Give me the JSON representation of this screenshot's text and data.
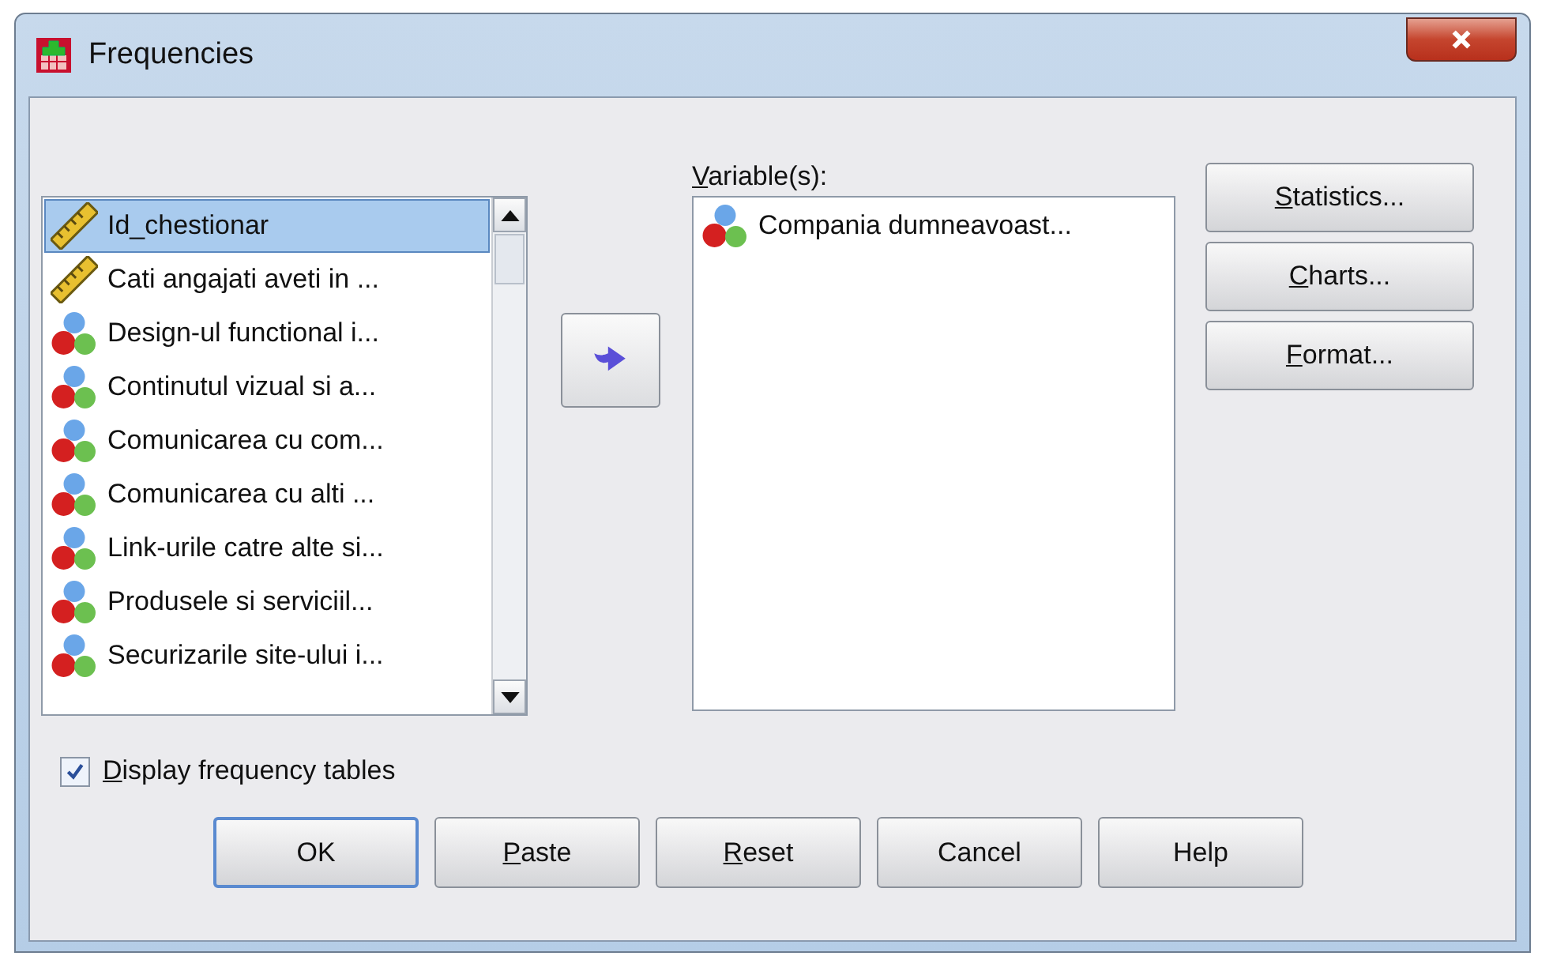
{
  "window": {
    "title": "Frequencies"
  },
  "source_list": {
    "items": [
      {
        "label": "Id_chestionar",
        "kind": "scale",
        "selected": true
      },
      {
        "label": "Cati angajati aveti in ...",
        "kind": "scale",
        "selected": false
      },
      {
        "label": "Design-ul functional i...",
        "kind": "nominal",
        "selected": false
      },
      {
        "label": "Continutul vizual si a...",
        "kind": "nominal",
        "selected": false
      },
      {
        "label": "Comunicarea cu com...",
        "kind": "nominal",
        "selected": false
      },
      {
        "label": "Comunicarea cu alti ...",
        "kind": "nominal",
        "selected": false
      },
      {
        "label": "Link-urile catre alte si...",
        "kind": "nominal",
        "selected": false
      },
      {
        "label": "Produsele si serviciil...",
        "kind": "nominal",
        "selected": false
      },
      {
        "label": "Securizarile site-ului i...",
        "kind": "nominal",
        "selected": false
      }
    ]
  },
  "variables": {
    "label": "Variable(s):",
    "mnemonic_underlined": true,
    "items": [
      {
        "label": "Compania dumneavoast...",
        "kind": "nominal",
        "selected": false
      }
    ]
  },
  "side_buttons": [
    {
      "label": "Statistics...",
      "mnemonic_underlined": true
    },
    {
      "label": "Charts...",
      "mnemonic_underlined": true
    },
    {
      "label": "Format...",
      "mnemonic_underlined": true
    }
  ],
  "display_tables": {
    "label": "Display frequency tables",
    "checked": true,
    "mnemonic_underlined": true
  },
  "buttons": [
    {
      "label": "OK",
      "mnemonic_underlined": false,
      "default": true
    },
    {
      "label": "Paste",
      "mnemonic_underlined": true,
      "default": false
    },
    {
      "label": "Reset",
      "mnemonic_underlined": true,
      "default": false
    },
    {
      "label": "Cancel",
      "mnemonic_underlined": false,
      "default": false
    },
    {
      "label": "Help",
      "mnemonic_underlined": false,
      "default": false
    }
  ]
}
